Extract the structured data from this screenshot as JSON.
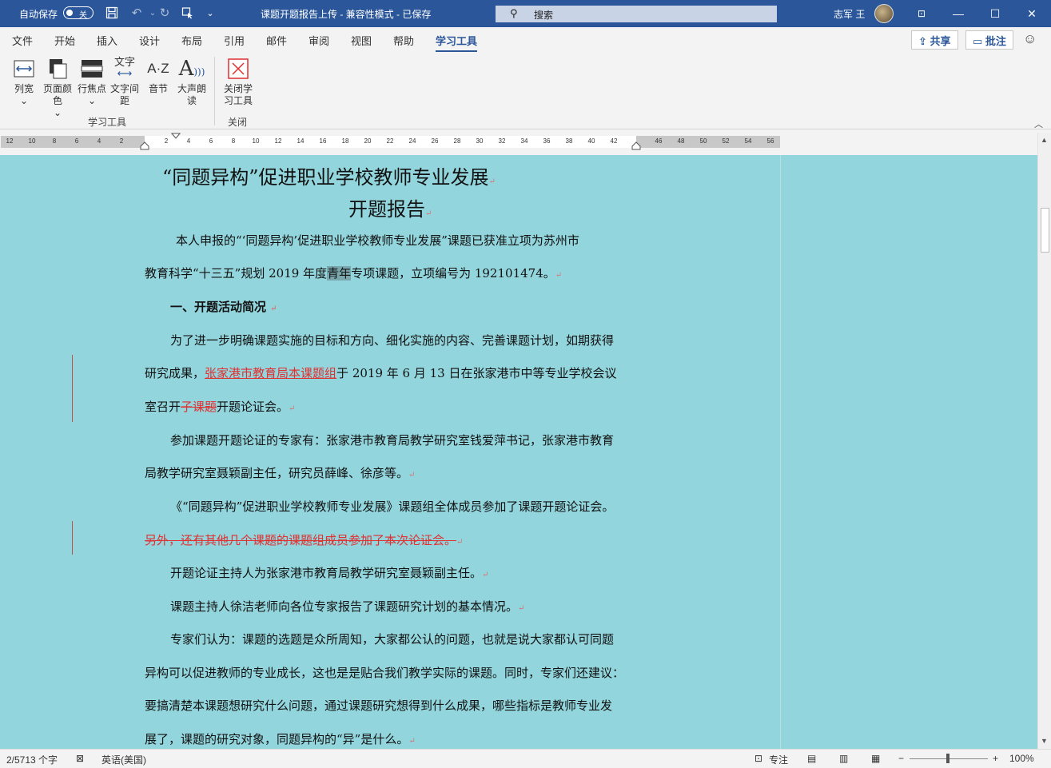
{
  "titlebar": {
    "autosave_label": "自动保存",
    "autosave_state": "关",
    "document_title": "课题开题报告上传  -  兼容性模式  -  已保存",
    "search_placeholder": "搜索",
    "user_name": "志军 王",
    "colors": {
      "bar": "#2b579a",
      "text": "#ffffff"
    }
  },
  "tabs": [
    "文件",
    "开始",
    "插入",
    "设计",
    "布局",
    "引用",
    "邮件",
    "审阅",
    "视图",
    "帮助",
    "学习工具"
  ],
  "active_tab": "学习工具",
  "share_label": "共享",
  "comments_label": "批注",
  "ribbon": {
    "buttons": [
      {
        "label": "列宽",
        "caret": "⌄"
      },
      {
        "label": "页面颜色",
        "caret": "⌄"
      },
      {
        "label": "行焦点",
        "caret": "⌄"
      },
      {
        "label": "文字间距"
      },
      {
        "label": "音节"
      },
      {
        "label": "大声朗读"
      },
      {
        "label": "关闭学习工具"
      }
    ],
    "icon_glyphs": {
      "text_spacing": "文字",
      "syllables": "A·Z",
      "read_aloud": "A"
    },
    "groups": [
      {
        "label": "学习工具"
      },
      {
        "label": "关闭"
      }
    ]
  },
  "ruler": {
    "ticks": [
      "12",
      "10",
      "8",
      "6",
      "4",
      "2",
      "2",
      "4",
      "6",
      "8",
      "10",
      "12",
      "14",
      "16",
      "18",
      "20",
      "22",
      "24",
      "26",
      "28",
      "30",
      "32",
      "34",
      "36",
      "38",
      "40",
      "42",
      "46",
      "48",
      "50",
      "52",
      "54",
      "56"
    ]
  },
  "document": {
    "page_color": "#92d5dc",
    "title1": "“同题异构”促进职业学校教师专业发展",
    "title2": "开题报告",
    "p1a": "本人申报的“‘同题异构’促进职业学校教师专业发展”课题已获准立项为苏州市",
    "p1b_pre": "教育科学“十三五”规划 2019 年度",
    "p1b_hl": "青年",
    "p1b_post": "专项课题，立项编号为 192101474。",
    "h1": "一、开题活动简况",
    "p2a": "为了进一步明确课题实施的目标和方向、细化实施的内容、完善课题计划，如期获得",
    "p2b_pre": "研究成果，",
    "p2b_ins1": "张家港市教育局",
    "p2b_ins2": "本课题组",
    "p2b_post": "于 2019 年 6 月 13 日在张家港市中等专业学校会议",
    "p2c_pre": "室召开",
    "p2c_del": "子课题",
    "p2c_post": "开题论证会。",
    "p3a": "参加课题开题论证的专家有：张家港市教育局教学研究室钱爱萍书记，张家港市教育",
    "p3b": "局教学研究室聂颖副主任，研究员薛峰、徐彦等。",
    "p4": "《“同题异构”促进职业学校教师专业发展》课题组全体成员参加了课题开题论证会。",
    "p5_del": "另外，还有其他几个课题的课题组成员参加了本次论证会。",
    "p6": "开题论证主持人为张家港市教育局教学研究室聂颖副主任。",
    "p7": "课题主持人徐洁老师向各位专家报告了课题研究计划的基本情况。",
    "p8a": "专家们认为：课题的选题是众所周知，大家都公认的问题，也就是说大家都认可同题",
    "p8b": "异构可以促进教师的专业成长，这也是是贴合我们教学实际的课题。同时，专家们还建议：",
    "p8c": "要搞清楚本课题想研究什么问题，通过课题研究想得到什么成果，哪些指标是教师专业发",
    "p8d": "展了，课题的研究对象，同题异构的“异”是什么。",
    "para_mark": "↵"
  },
  "statusbar": {
    "word_count": "2/5713 个字",
    "language": "英语(美国)",
    "focus": "专注",
    "zoom": "100%"
  }
}
